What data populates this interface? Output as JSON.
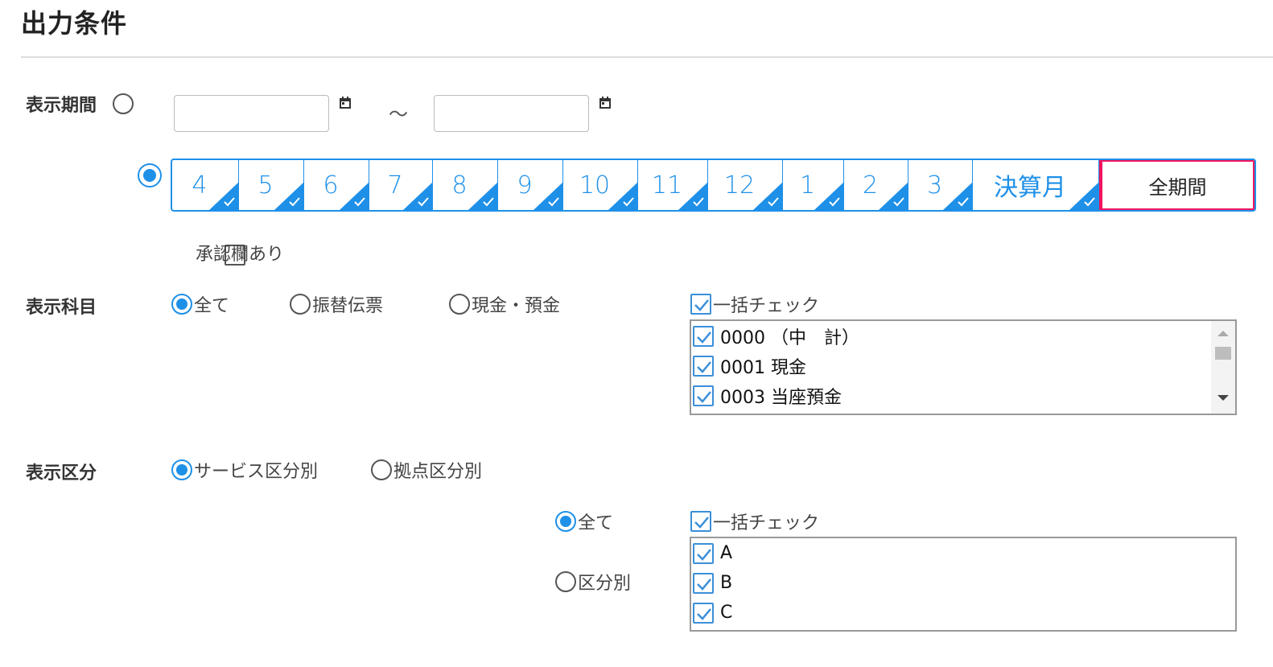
{
  "title": "出力条件",
  "period": {
    "label": "表示期間",
    "tilde": "～",
    "months": [
      {
        "label": "4",
        "checked": true
      },
      {
        "label": "5",
        "checked": true
      },
      {
        "label": "6",
        "checked": true
      },
      {
        "label": "7",
        "checked": true
      },
      {
        "label": "8",
        "checked": true
      },
      {
        "label": "9",
        "checked": true
      },
      {
        "label": "10",
        "checked": true
      },
      {
        "label": "11",
        "checked": true
      },
      {
        "label": "12",
        "checked": true
      },
      {
        "label": "1",
        "checked": true
      },
      {
        "label": "2",
        "checked": true
      },
      {
        "label": "3",
        "checked": true
      },
      {
        "label": "決算月",
        "checked": true
      }
    ],
    "all_period_label": "全期間",
    "approval_label": "承認欄あり"
  },
  "accounts": {
    "label": "表示科目",
    "options": [
      "全て",
      "振替伝票",
      "現金・預金"
    ],
    "bulk_check_label": "一括チェック",
    "items": [
      "0000 （中　計）",
      "0001 現金",
      "0003 当座預金"
    ]
  },
  "division": {
    "label": "表示区分",
    "options": [
      "サービス区分別",
      "拠点区分別"
    ],
    "sub_options": [
      "全て",
      "区分別"
    ],
    "bulk_check_label": "一括チェック",
    "items": [
      "A",
      "B",
      "C"
    ]
  },
  "colors": {
    "accent": "#1e90e8",
    "highlight": "#f0155f"
  }
}
